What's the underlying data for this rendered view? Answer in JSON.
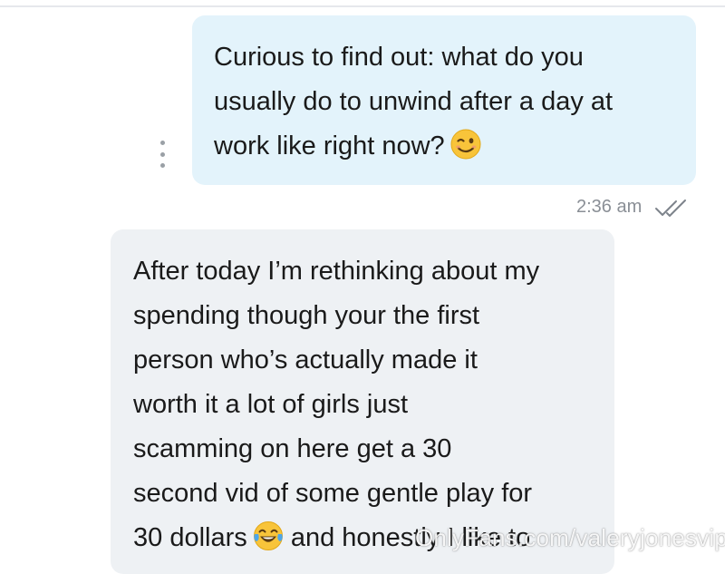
{
  "chat": {
    "outgoing": {
      "lines": [
        "Curious to find out: what do you",
        "usually do to unwind after a day at",
        "work like right now?"
      ],
      "emoji": "winking-face",
      "time": "2:36 am",
      "status_icon": "double-check-read"
    },
    "incoming": {
      "lines": [
        "After today I’m rethinking about my",
        "spending though your the first",
        "person who’s actually made it",
        "worth it a lot of girls just",
        "scamming on here get a 30",
        "second vid of some gentle play for",
        "30 dollars",
        "and honestly I like to"
      ],
      "emoji": "face-with-tears-of-joy"
    },
    "more_icon": "vertical-ellipsis"
  },
  "watermark": "OnlyFans.com/valeryjonesvip",
  "colors": {
    "outgoing_bubble": "#e3f3fb",
    "incoming_bubble": "#eef1f4",
    "text": "#1a1a1a",
    "timestamp": "#8a8f96"
  }
}
